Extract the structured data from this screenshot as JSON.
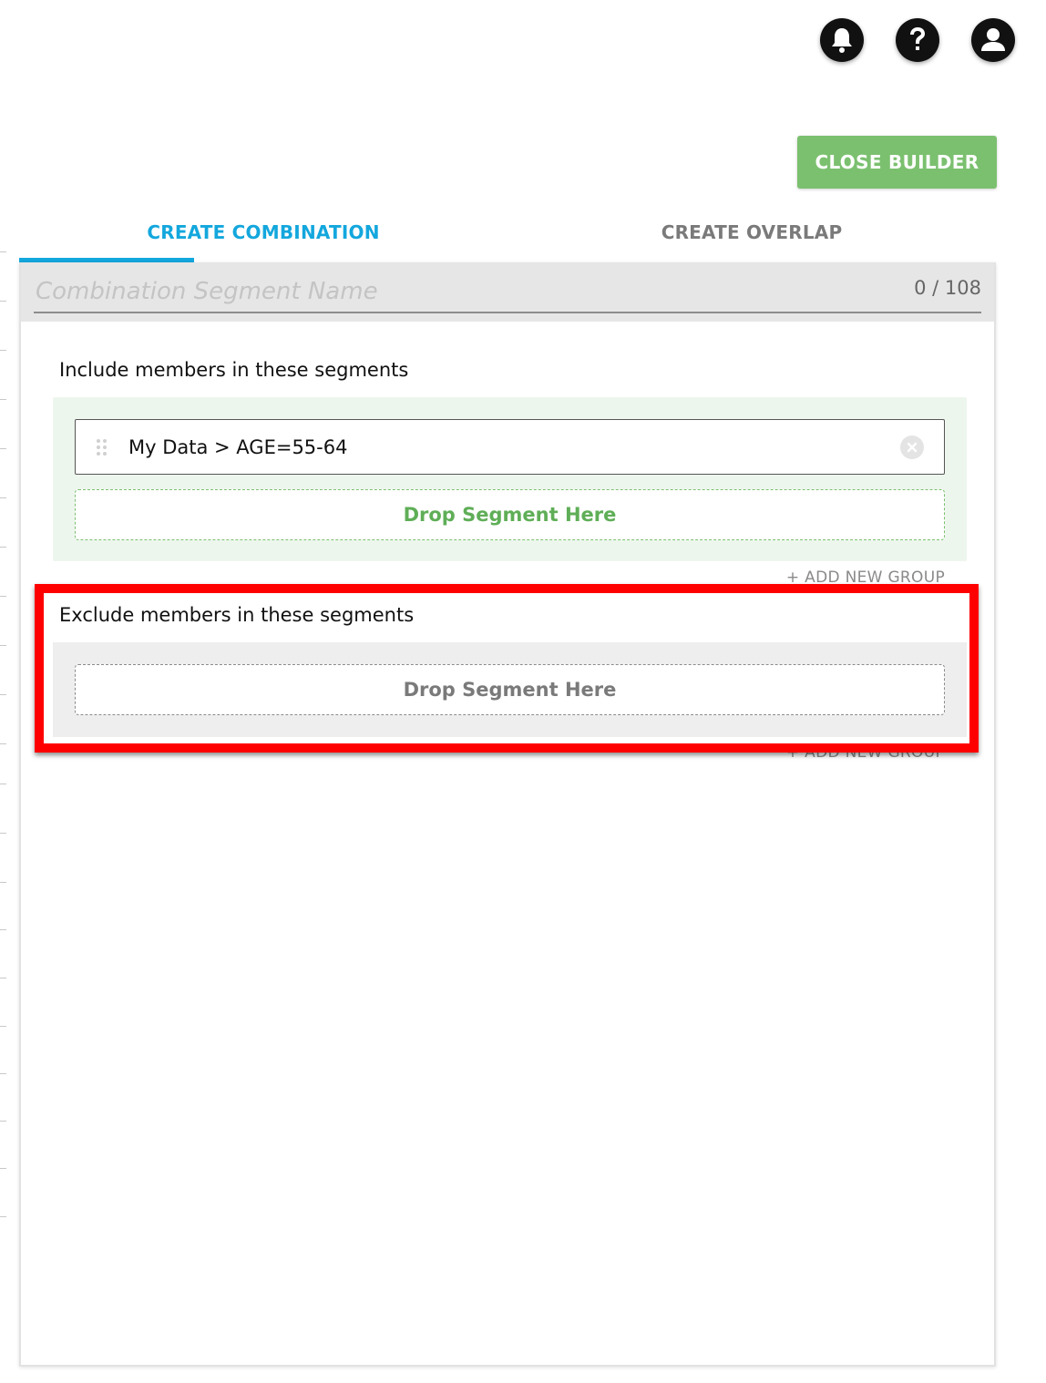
{
  "header": {
    "icons": [
      "bell-icon",
      "help-icon",
      "account-icon"
    ]
  },
  "builder": {
    "close_label": "CLOSE BUILDER",
    "close_color": "#7bc06f"
  },
  "tabs": {
    "active_color": "#13a7dd",
    "items": [
      {
        "label": "CREATE COMBINATION",
        "active": true
      },
      {
        "label": "CREATE OVERLAP",
        "active": false
      }
    ]
  },
  "segment_name": {
    "placeholder": "Combination Segment Name",
    "value": "",
    "counter": "0 / 108"
  },
  "include": {
    "title": "Include members in these segments",
    "segments": [
      {
        "label": "My Data > AGE=55-64"
      }
    ],
    "drop_label": "Drop Segment Here",
    "add_group_label": "+ ADD NEW GROUP"
  },
  "exclude": {
    "title": "Exclude members in these segments",
    "drop_label": "Drop Segment Here",
    "add_group_label": "+ ADD NEW GROUP",
    "highlight_color": "#ff0000"
  }
}
